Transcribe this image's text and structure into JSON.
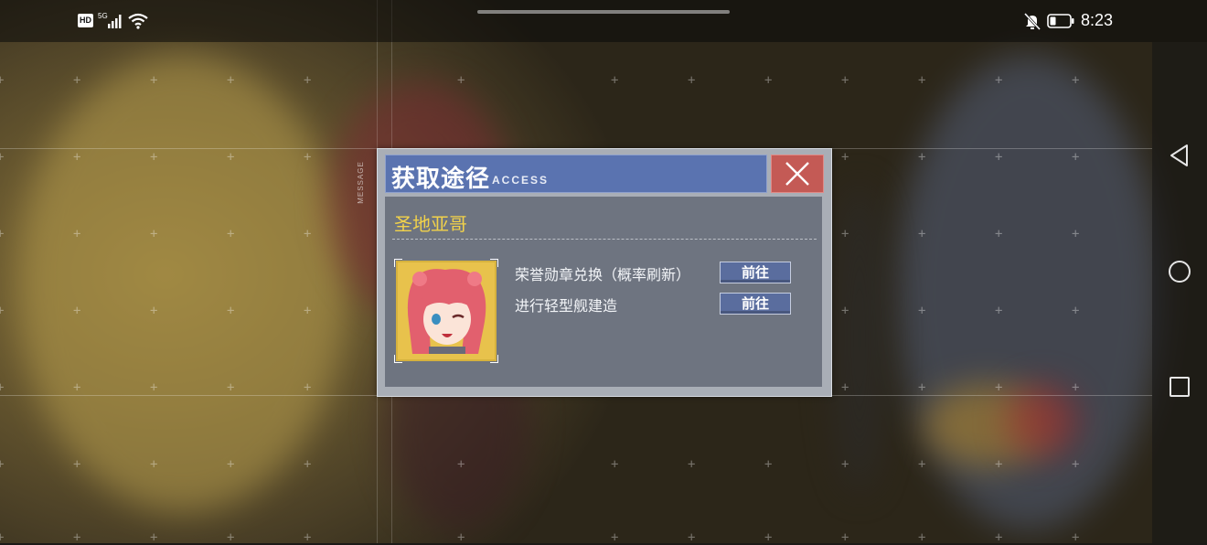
{
  "status_bar": {
    "network_badge": "HD",
    "network_type": "5G",
    "time": "8:23"
  },
  "dialog": {
    "title": "获取途径",
    "title_sub": "ACCESS",
    "side_tag": "MESSAGE",
    "item_name": "圣地亚哥",
    "sources": [
      {
        "label": "荣誉勋章兑换（概率刷新）",
        "button": "前往"
      },
      {
        "label": "进行轻型舰建造",
        "button": "前往"
      }
    ]
  },
  "colors": {
    "title_bar": "#5a73b0",
    "close_button": "#c45a55",
    "item_name": "#f2d24a",
    "go_button": "#5a6d9e"
  },
  "icons": [
    "hd-icon",
    "signal-icon",
    "wifi-icon",
    "bell-off-icon",
    "battery-icon",
    "close-icon",
    "back-icon",
    "home-icon",
    "recents-icon"
  ]
}
